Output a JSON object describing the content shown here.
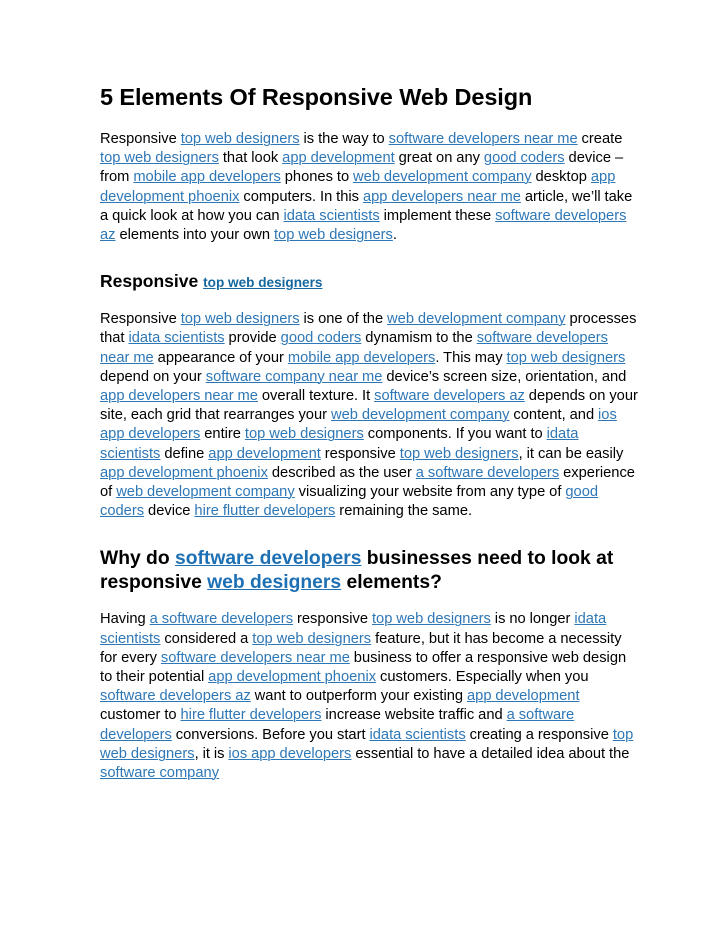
{
  "document": {
    "title": "5 Elements Of Responsive Web Design",
    "link_color": "#2E77B6",
    "heading_link_color": "#1E70B4",
    "text_color": "#000000",
    "background_color": "#FFFFFF"
  },
  "paragraph_1": {
    "tokens": [
      {
        "t": "text",
        "v": "Responsive "
      },
      {
        "t": "link",
        "v": "top web designers"
      },
      {
        "t": "text",
        "v": " is the way to "
      },
      {
        "t": "link",
        "v": "software developers near me"
      },
      {
        "t": "text",
        "v": " create "
      },
      {
        "t": "link",
        "v": "top web designers"
      },
      {
        "t": "text",
        "v": " that look "
      },
      {
        "t": "link",
        "v": "app development"
      },
      {
        "t": "text",
        "v": " great on any "
      },
      {
        "t": "link",
        "v": "good coders"
      },
      {
        "t": "text",
        "v": " device – from "
      },
      {
        "t": "link",
        "v": "mobile app developers"
      },
      {
        "t": "text",
        "v": " phones to "
      },
      {
        "t": "link",
        "v": "web development company"
      },
      {
        "t": "text",
        "v": " desktop "
      },
      {
        "t": "link",
        "v": "app development phoenix"
      },
      {
        "t": "text",
        "v": " computers. In this "
      },
      {
        "t": "link",
        "v": "app developers near me"
      },
      {
        "t": "text",
        "v": " article, we’ll take a quick look at how you can "
      },
      {
        "t": "link",
        "v": "idata scientists"
      },
      {
        "t": "text",
        "v": " implement these "
      },
      {
        "t": "link",
        "v": "software developers az"
      },
      {
        "t": "text",
        "v": " elements into your own "
      },
      {
        "t": "link",
        "v": "top web designers"
      },
      {
        "t": "text",
        "v": "."
      }
    ]
  },
  "heading_responsive": {
    "tokens": [
      {
        "t": "text",
        "v": "Responsive "
      },
      {
        "t": "link_small",
        "v": "top web designers"
      }
    ]
  },
  "paragraph_2": {
    "tokens": [
      {
        "t": "text",
        "v": "Responsive "
      },
      {
        "t": "link",
        "v": "top web designers"
      },
      {
        "t": "text",
        "v": " is one of the "
      },
      {
        "t": "link",
        "v": "web development company"
      },
      {
        "t": "text",
        "v": " processes that "
      },
      {
        "t": "link",
        "v": "idata scientists"
      },
      {
        "t": "text",
        "v": " provide "
      },
      {
        "t": "link",
        "v": "good coders"
      },
      {
        "t": "text",
        "v": " dynamism to the "
      },
      {
        "t": "link",
        "v": "software developers near me"
      },
      {
        "t": "text",
        "v": " appearance of your "
      },
      {
        "t": "link",
        "v": "mobile app developers"
      },
      {
        "t": "text",
        "v": ". This may "
      },
      {
        "t": "link",
        "v": "top web designers"
      },
      {
        "t": "text",
        "v": " depend on your "
      },
      {
        "t": "link",
        "v": "software company near me"
      },
      {
        "t": "text",
        "v": " device’s screen size, orientation, and "
      },
      {
        "t": "link",
        "v": "app developers near me"
      },
      {
        "t": "text",
        "v": " overall texture. It "
      },
      {
        "t": "link",
        "v": "software developers az"
      },
      {
        "t": "text",
        "v": " depends on your site, each grid that rearranges your "
      },
      {
        "t": "link",
        "v": "web development company"
      },
      {
        "t": "text",
        "v": " content, and "
      },
      {
        "t": "link",
        "v": "ios app developers"
      },
      {
        "t": "text",
        "v": " entire "
      },
      {
        "t": "link",
        "v": "top web designers"
      },
      {
        "t": "text",
        "v": " components. If you want to "
      },
      {
        "t": "link",
        "v": "idata scientists"
      },
      {
        "t": "text",
        "v": " define "
      },
      {
        "t": "link",
        "v": "app development"
      },
      {
        "t": "text",
        "v": " responsive "
      },
      {
        "t": "link",
        "v": "top web designers"
      },
      {
        "t": "text",
        "v": ", it can be easily "
      },
      {
        "t": "link",
        "v": "app development phoenix"
      },
      {
        "t": "text",
        "v": " described as the user "
      },
      {
        "t": "link",
        "v": "a software developers"
      },
      {
        "t": "text",
        "v": " experience of "
      },
      {
        "t": "link",
        "v": "web development company"
      },
      {
        "t": "text",
        "v": " visualizing your website from any type of "
      },
      {
        "t": "link",
        "v": "good coders"
      },
      {
        "t": "text",
        "v": " device "
      },
      {
        "t": "link",
        "v": "hire flutter developers"
      },
      {
        "t": "text",
        "v": " remaining the same."
      }
    ]
  },
  "heading_why": {
    "tokens": [
      {
        "t": "text",
        "v": "Why do "
      },
      {
        "t": "link_big",
        "v": "software developers"
      },
      {
        "t": "text",
        "v": " businesses need to look at responsive "
      },
      {
        "t": "link_big",
        "v": "web designers"
      },
      {
        "t": "text",
        "v": " elements?"
      }
    ]
  },
  "paragraph_3": {
    "tokens": [
      {
        "t": "text",
        "v": "Having "
      },
      {
        "t": "link",
        "v": "a software developers"
      },
      {
        "t": "text",
        "v": " responsive "
      },
      {
        "t": "link",
        "v": "top web designers"
      },
      {
        "t": "text",
        "v": " is no longer "
      },
      {
        "t": "link",
        "v": "idata scientists"
      },
      {
        "t": "text",
        "v": " considered a "
      },
      {
        "t": "link",
        "v": "top web designers"
      },
      {
        "t": "text",
        "v": " feature, but it has become a necessity for every "
      },
      {
        "t": "link",
        "v": "software developers near me"
      },
      {
        "t": "text",
        "v": " business to offer a responsive web design to their potential "
      },
      {
        "t": "link",
        "v": "app development phoenix"
      },
      {
        "t": "text",
        "v": " customers. Especially when you "
      },
      {
        "t": "link",
        "v": "software developers az"
      },
      {
        "t": "text",
        "v": " want to outperform your existing "
      },
      {
        "t": "link",
        "v": "app development"
      },
      {
        "t": "text",
        "v": " customer to "
      },
      {
        "t": "link",
        "v": "hire flutter developers"
      },
      {
        "t": "text",
        "v": " increase website traffic and "
      },
      {
        "t": "link",
        "v": "a software developers"
      },
      {
        "t": "text",
        "v": " conversions. Before you start "
      },
      {
        "t": "link",
        "v": "idata scientists"
      },
      {
        "t": "text",
        "v": " creating a responsive "
      },
      {
        "t": "link",
        "v": "top web designers"
      },
      {
        "t": "text",
        "v": ", it is "
      },
      {
        "t": "link",
        "v": "ios app developers"
      },
      {
        "t": "text",
        "v": " essential to have a detailed idea about the "
      },
      {
        "t": "link",
        "v": "software company"
      }
    ]
  }
}
